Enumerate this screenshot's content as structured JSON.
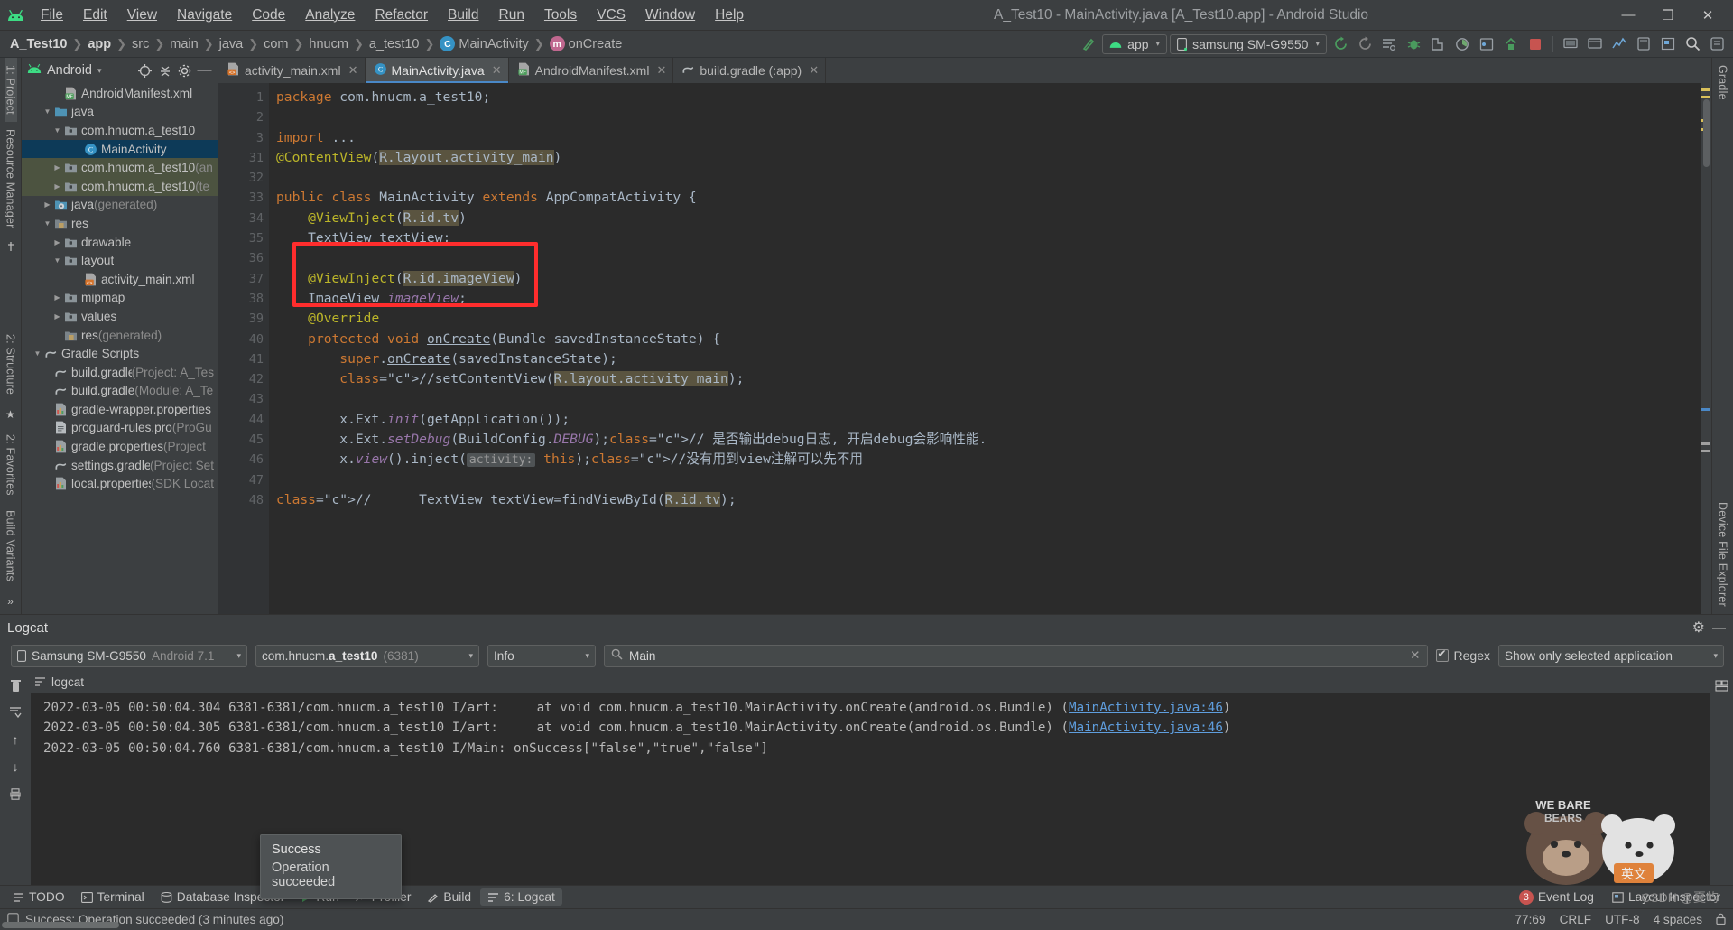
{
  "window": {
    "title": "A_Test10 - MainActivity.java [A_Test10.app] - Android Studio",
    "minimize": "—",
    "maximize": "❐",
    "close": "✕"
  },
  "menubar": {
    "items": [
      {
        "label": "File"
      },
      {
        "label": "Edit"
      },
      {
        "label": "View"
      },
      {
        "label": "Navigate"
      },
      {
        "label": "Code"
      },
      {
        "label": "Analyze"
      },
      {
        "label": "Refactor"
      },
      {
        "label": "Build"
      },
      {
        "label": "Run"
      },
      {
        "label": "Tools"
      },
      {
        "label": "VCS"
      },
      {
        "label": "Window"
      },
      {
        "label": "Help"
      }
    ]
  },
  "breadcrumb": {
    "items": [
      {
        "label": "A_Test10",
        "bold": true,
        "badge": ""
      },
      {
        "label": "app",
        "bold": true,
        "badge": ""
      },
      {
        "label": "src",
        "bold": false,
        "badge": ""
      },
      {
        "label": "main",
        "bold": false,
        "badge": ""
      },
      {
        "label": "java",
        "bold": false,
        "badge": ""
      },
      {
        "label": "com",
        "bold": false,
        "badge": ""
      },
      {
        "label": "hnucm",
        "bold": false,
        "badge": ""
      },
      {
        "label": "a_test10",
        "bold": false,
        "badge": ""
      },
      {
        "label": "MainActivity",
        "bold": false,
        "badge": "C"
      },
      {
        "label": "onCreate",
        "bold": false,
        "badge": "m"
      }
    ],
    "separator": "❯"
  },
  "toolbar": {
    "run_config": "app",
    "device": "samsung SM-G9550",
    "caret": "▾",
    "icons": [
      "make-project-icon",
      "sync-gradle-icon",
      "avd-manager-icon",
      "sdk-manager-icon",
      "run-icon",
      "debug-icon",
      "profile-icon",
      "stop-icon",
      "attach-debugger-icon",
      "layout-inspector-icon",
      "device-manager-icon",
      "search-icon"
    ]
  },
  "left_rail": {
    "items": [
      {
        "label": "1: Project",
        "selected": true
      },
      {
        "label": "Resource Manager",
        "selected": false
      }
    ],
    "bottom_items": [
      {
        "label": "2: Structure"
      },
      {
        "label": "2: Favorites"
      },
      {
        "label": "Build Variants"
      }
    ]
  },
  "right_rail": {
    "items": [
      {
        "label": "Gradle"
      },
      {
        "label": "Device File Explorer"
      }
    ]
  },
  "project_panel": {
    "title": "Android",
    "caret": "▾",
    "buttons": [
      "locate-icon",
      "collapse-all-icon",
      "settings-icon",
      "hide-icon"
    ],
    "tree": [
      {
        "indent": 3,
        "arrow": "",
        "icon": "manifest",
        "label": "AndroidManifest.xml",
        "dim": "",
        "state": "normal"
      },
      {
        "indent": 2,
        "arrow": "▼",
        "icon": "folder-java",
        "label": "java",
        "dim": "",
        "state": "normal"
      },
      {
        "indent": 3,
        "arrow": "▼",
        "icon": "package",
        "label": "com.hnucm.a_test10",
        "dim": "",
        "state": "normal"
      },
      {
        "indent": 5,
        "arrow": "",
        "icon": "class",
        "label": "MainActivity",
        "dim": "",
        "state": "selected"
      },
      {
        "indent": 3,
        "arrow": "▶",
        "icon": "package",
        "label": "com.hnucm.a_test10",
        "dim": " (an",
        "state": "group"
      },
      {
        "indent": 3,
        "arrow": "▶",
        "icon": "package",
        "label": "com.hnucm.a_test10",
        "dim": " (te",
        "state": "group"
      },
      {
        "indent": 2,
        "arrow": "▶",
        "icon": "folder-gen",
        "label": "java",
        "dim": " (generated)",
        "state": "normal"
      },
      {
        "indent": 2,
        "arrow": "▼",
        "icon": "folder-res",
        "label": "res",
        "dim": "",
        "state": "normal"
      },
      {
        "indent": 3,
        "arrow": "▶",
        "icon": "package",
        "label": "drawable",
        "dim": "",
        "state": "normal"
      },
      {
        "indent": 3,
        "arrow": "▼",
        "icon": "package",
        "label": "layout",
        "dim": "",
        "state": "normal"
      },
      {
        "indent": 5,
        "arrow": "",
        "icon": "xml",
        "label": "activity_main.xml",
        "dim": "",
        "state": "normal"
      },
      {
        "indent": 3,
        "arrow": "▶",
        "icon": "package",
        "label": "mipmap",
        "dim": "",
        "state": "normal"
      },
      {
        "indent": 3,
        "arrow": "▶",
        "icon": "package",
        "label": "values",
        "dim": "",
        "state": "normal"
      },
      {
        "indent": 3,
        "arrow": "",
        "icon": "folder-res",
        "label": "res",
        "dim": " (generated)",
        "state": "normal"
      },
      {
        "indent": 1,
        "arrow": "▼",
        "icon": "gradle",
        "label": "Gradle Scripts",
        "dim": "",
        "state": "normal"
      },
      {
        "indent": 2,
        "arrow": "",
        "icon": "gradle",
        "label": "build.gradle",
        "dim": " (Project: A_Tes",
        "state": "normal"
      },
      {
        "indent": 2,
        "arrow": "",
        "icon": "gradle",
        "label": "build.gradle",
        "dim": " (Module: A_Te",
        "state": "normal"
      },
      {
        "indent": 2,
        "arrow": "",
        "icon": "props",
        "label": "gradle-wrapper.properties",
        "dim": "",
        "state": "normal"
      },
      {
        "indent": 2,
        "arrow": "",
        "icon": "file",
        "label": "proguard-rules.pro",
        "dim": " (ProGu",
        "state": "normal"
      },
      {
        "indent": 2,
        "arrow": "",
        "icon": "props",
        "label": "gradle.properties",
        "dim": " (Project ",
        "state": "normal"
      },
      {
        "indent": 2,
        "arrow": "",
        "icon": "gradle",
        "label": "settings.gradle",
        "dim": " (Project Set",
        "state": "normal"
      },
      {
        "indent": 2,
        "arrow": "",
        "icon": "props",
        "label": "local.properties",
        "dim": " (SDK Locat",
        "state": "normal"
      }
    ]
  },
  "editor_tabs": [
    {
      "label": "activity_main.xml",
      "icon": "xml",
      "active": false,
      "close": "✕"
    },
    {
      "label": "MainActivity.java",
      "icon": "class",
      "active": true,
      "close": "✕"
    },
    {
      "label": "AndroidManifest.xml",
      "icon": "manifest",
      "active": false,
      "close": "✕"
    },
    {
      "label": "build.gradle (:app)",
      "icon": "gradle",
      "active": false,
      "close": "✕"
    }
  ],
  "code": {
    "lines": [
      {
        "no": "1",
        "text": "package com.hnucm.a_test10;"
      },
      {
        "no": "2",
        "text": ""
      },
      {
        "no": "3",
        "text": "import ..."
      },
      {
        "no": "31",
        "text": "@ContentView(R.layout.activity_main)"
      },
      {
        "no": "32",
        "text": ""
      },
      {
        "no": "33",
        "text": "public class MainActivity extends AppCompatActivity {"
      },
      {
        "no": "34",
        "text": "    @ViewInject(R.id.tv)"
      },
      {
        "no": "35",
        "text": "    TextView textView;"
      },
      {
        "no": "36",
        "text": ""
      },
      {
        "no": "37",
        "text": "    @ViewInject(R.id.imageView)"
      },
      {
        "no": "38",
        "text": "    ImageView imageView;"
      },
      {
        "no": "39",
        "text": "    @Override"
      },
      {
        "no": "40",
        "text": "    protected void onCreate(Bundle savedInstanceState) {"
      },
      {
        "no": "41",
        "text": "        super.onCreate(savedInstanceState);"
      },
      {
        "no": "42",
        "text": "        //setContentView(R.layout.activity_main);"
      },
      {
        "no": "43",
        "text": ""
      },
      {
        "no": "44",
        "text": "        x.Ext.init(getApplication());"
      },
      {
        "no": "45",
        "text": "        x.Ext.setDebug(BuildConfig.DEBUG);// 是否输出debug日志, 开启debug会影响性能."
      },
      {
        "no": "46",
        "text": "        x.view().inject( activity: this);//没有用到view注解可以先不用"
      },
      {
        "no": "47",
        "text": ""
      },
      {
        "no": "48",
        "text": "//      TextView textView=findViewById(R.id.tv);"
      }
    ]
  },
  "logcat": {
    "title": "Logcat",
    "gear": "⚙",
    "minimize": "—",
    "device": "Samsung SM-G9550",
    "device_os": "Android 7.1",
    "device_icon": "phone-icon",
    "process": "com.hnucm.a_test10",
    "process_pid": "(6381)",
    "level": "Info",
    "search_placeholder": "Main",
    "search_value": "Main",
    "search_icon": "search-icon",
    "clear_search": "✕",
    "regex_label": "Regex",
    "scope": "Show only selected application",
    "caret": "▾",
    "tab_label": "logcat",
    "lines": [
      {
        "pre": "2022-03-05 00:50:04.304 6381-6381/com.hnucm.a_test10 I/art:     at void com.hnucm.a_test10.MainActivity.onCreate(android.os.Bundle) (",
        "link": "MainActivity.java:46",
        "post": ")"
      },
      {
        "pre": "2022-03-05 00:50:04.305 6381-6381/com.hnucm.a_test10 I/art:     at void com.hnucm.a_test10.MainActivity.onCreate(android.os.Bundle) (",
        "link": "MainActivity.java:46",
        "post": ")"
      },
      {
        "pre": "2022-03-05 00:50:04.760 6381-6381/com.hnucm.a_test10 I/Main: onSuccess[\"false\",\"true\",\"false\"]",
        "link": "",
        "post": ""
      }
    ],
    "side_buttons": [
      "clear-logcat-icon",
      "scroll-to-end-icon",
      "up-icon",
      "down-icon",
      "print-icon",
      "expand-icon"
    ]
  },
  "balloon": {
    "title": "Success",
    "message": "Operation succeeded"
  },
  "bottom_toolbar": {
    "left": [
      {
        "label": "TODO",
        "icon": "todo-icon",
        "selected": false
      },
      {
        "label": "Terminal",
        "icon": "terminal-icon",
        "selected": false
      },
      {
        "label": "Database Inspector",
        "icon": "db-icon",
        "selected": false
      },
      {
        "label": "Run",
        "icon": "run-icon",
        "selected": false
      },
      {
        "label": "Profiler",
        "icon": "profiler-icon",
        "selected": false
      },
      {
        "label": "Build",
        "icon": "build-icon",
        "selected": false
      },
      {
        "label": "6: Logcat",
        "icon": "logcat-icon",
        "selected": true
      }
    ],
    "right": [
      {
        "label": "Event Log",
        "icon": "event-log-icon",
        "badge": "3"
      },
      {
        "label": "Layout Inspector",
        "icon": "layout-inspector-icon",
        "badge": ""
      }
    ]
  },
  "statusbar": {
    "message": "Success: Operation succeeded (3 minutes ago)",
    "icon": "info-icon",
    "caret_position": "77:69",
    "line_separator": "CRLF",
    "encoding": "UTF-8",
    "indent": "4 spaces",
    "lock_icon": "lock-icon"
  },
  "watermark": {
    "line1": "WE BARE",
    "line2": "BEARS",
    "cn": "英文",
    "credit": "CSDN @夏屿"
  },
  "colors": {
    "accent": "#4a88c7",
    "android_green": "#3ddc84",
    "red_box": "#ff2d2d",
    "selection": "#0d3a58",
    "group_bg": "#4c5340",
    "editor_bg": "#2b2b2b",
    "panel_bg": "#3c3f41"
  }
}
